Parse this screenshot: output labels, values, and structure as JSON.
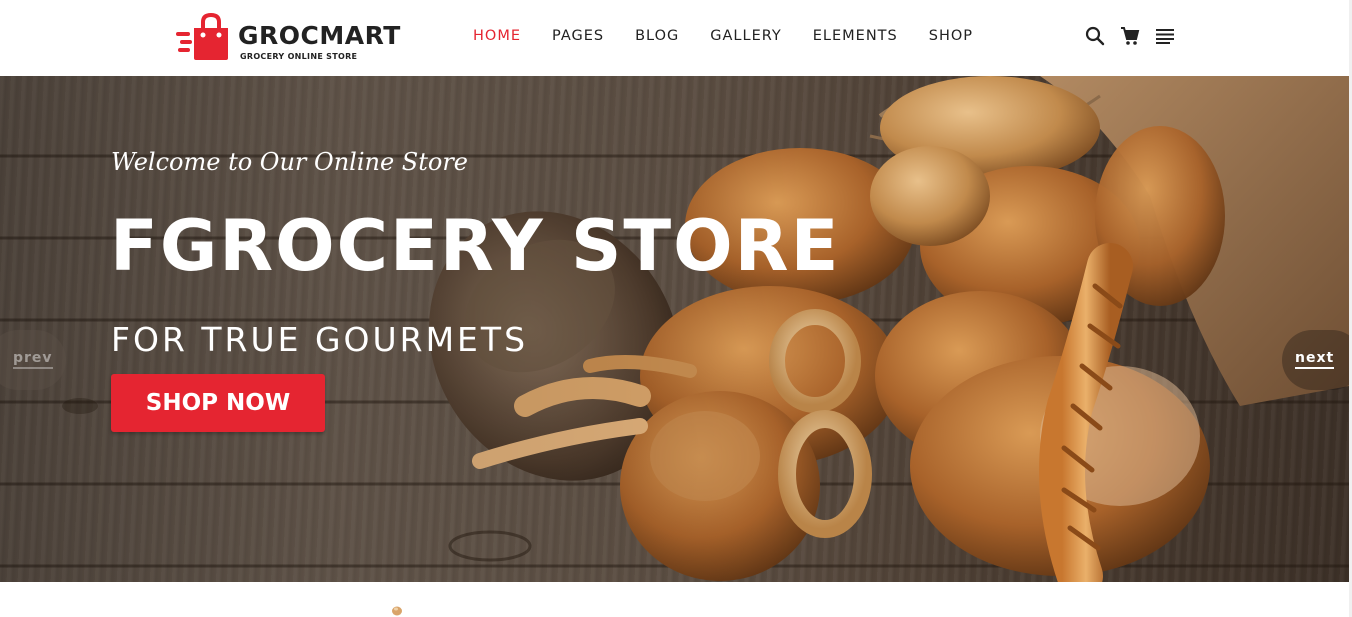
{
  "brand": {
    "name": "GROCMART",
    "tagline": "GROCERY ONLINE STORE",
    "accent_color": "#e52531",
    "icon": "shopping-bag-speed-icon"
  },
  "nav": {
    "items": [
      {
        "label": "HOME",
        "active": true
      },
      {
        "label": "PAGES",
        "active": false
      },
      {
        "label": "BLOG",
        "active": false
      },
      {
        "label": "GALLERY",
        "active": false
      },
      {
        "label": "ELEMENTS",
        "active": false
      },
      {
        "label": "SHOP",
        "active": false
      }
    ]
  },
  "tools": {
    "icons": [
      "search-icon",
      "cart-icon",
      "menu-icon"
    ]
  },
  "hero": {
    "welcome": "Welcome to Our Online Store",
    "headline": "FGROCERY STORE",
    "subheadline": "FOR TRUE GOURMETS",
    "cta_label": "SHOP NOW",
    "prev_label": "prev",
    "next_label": "next"
  }
}
